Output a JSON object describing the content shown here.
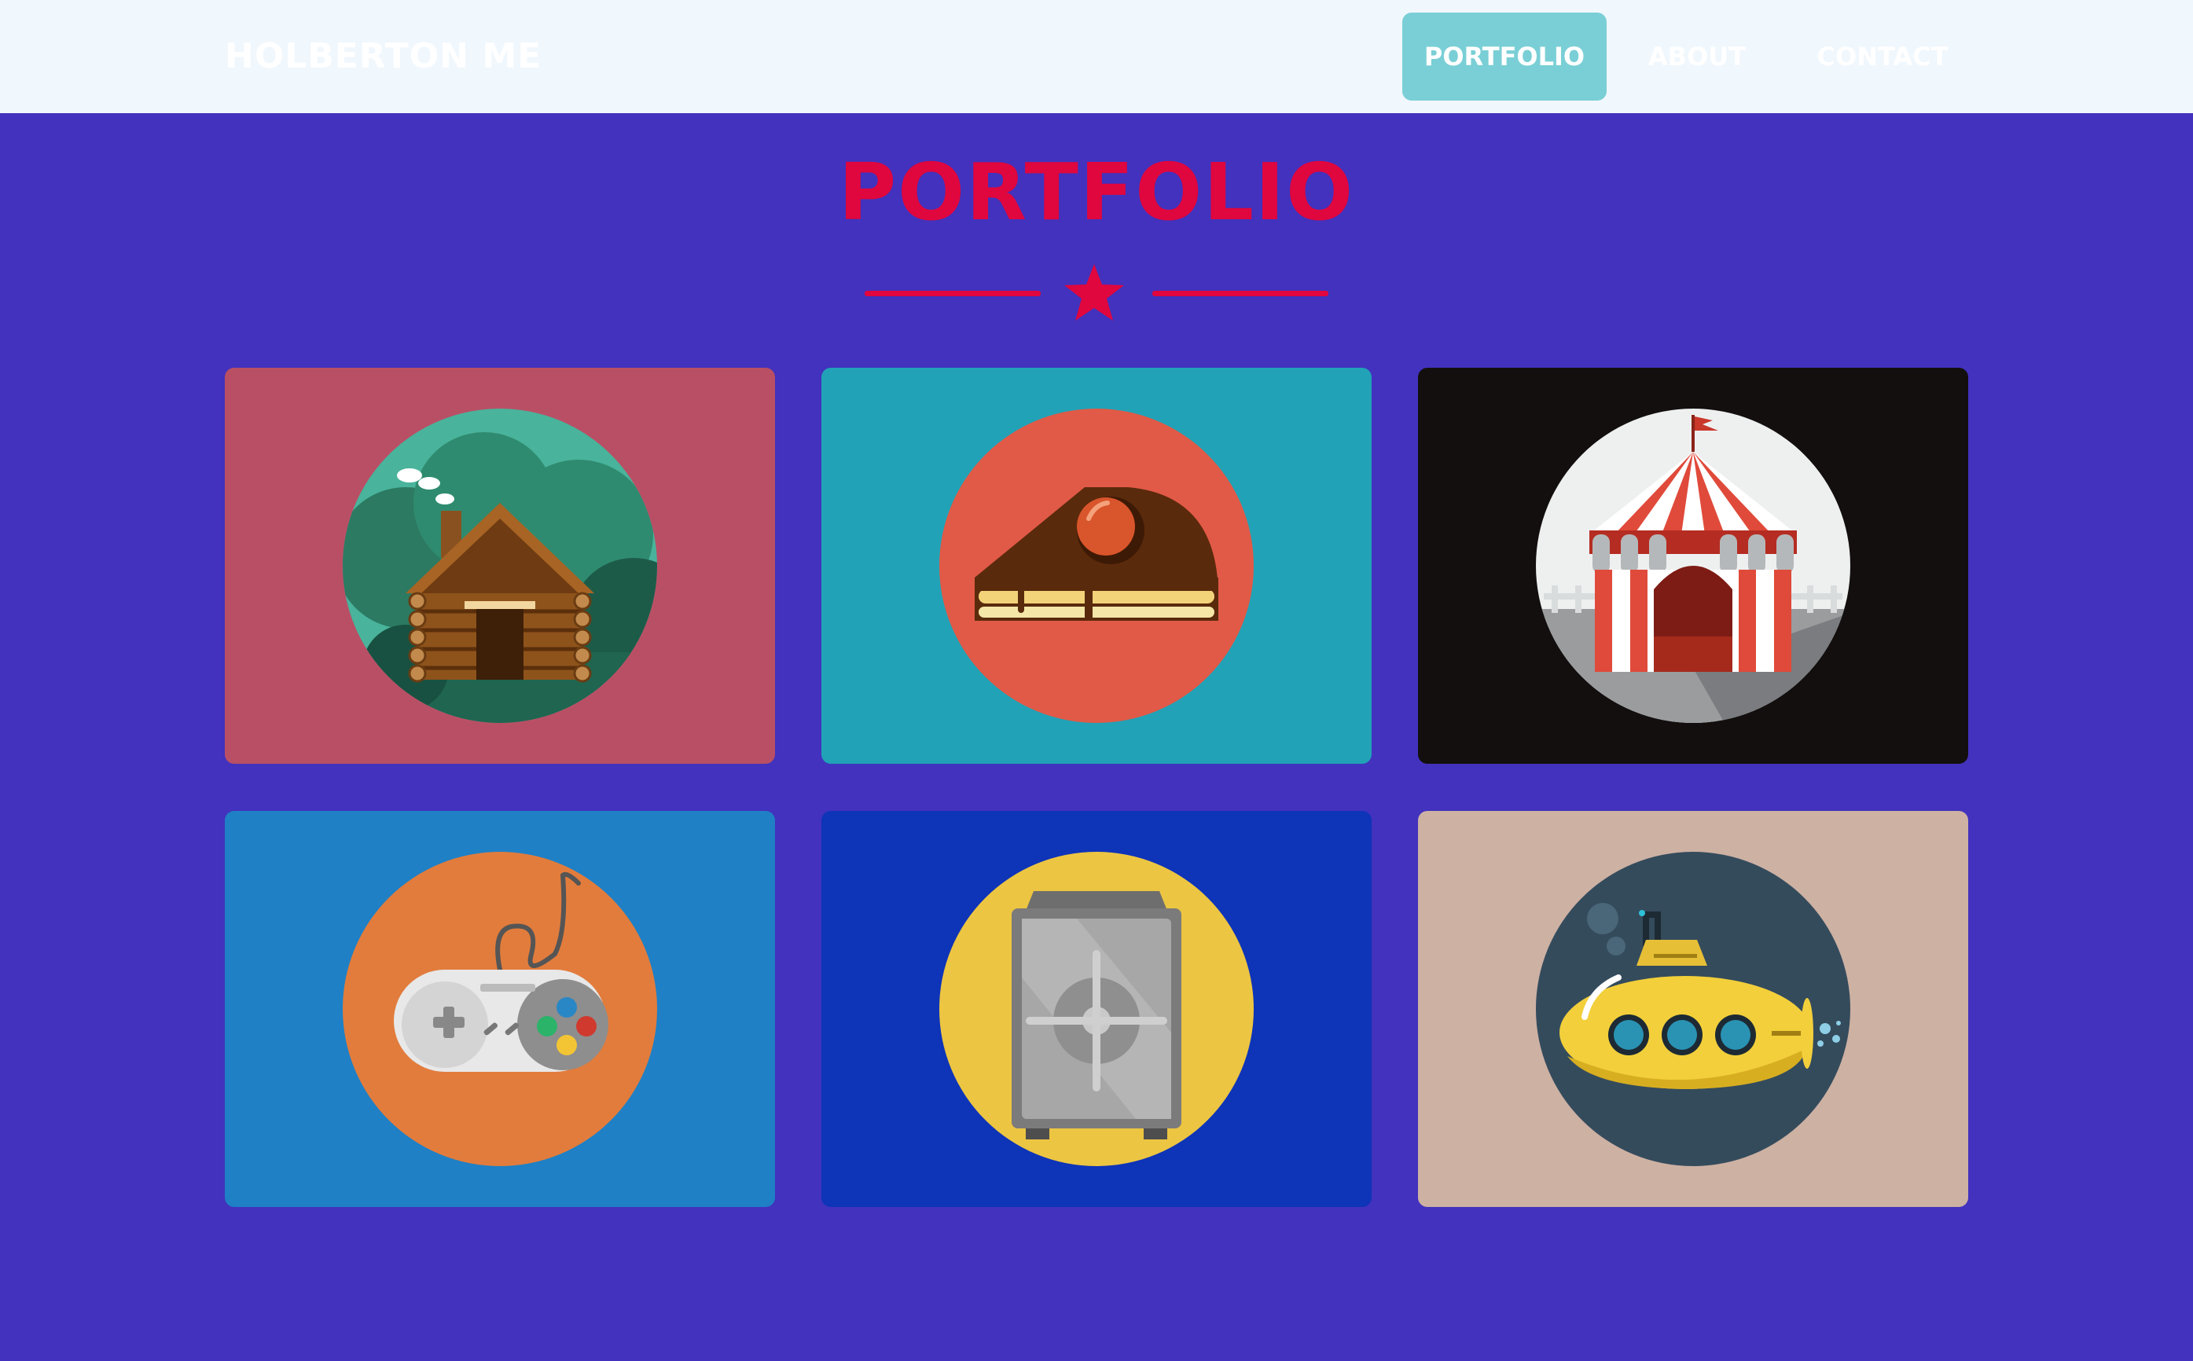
{
  "header": {
    "brand": "HOLBERTON ME",
    "nav": [
      {
        "label": "PORTFOLIO",
        "active": true
      },
      {
        "label": "ABOUT",
        "active": false
      },
      {
        "label": "CONTACT",
        "active": false
      }
    ]
  },
  "section": {
    "title": "PORTFOLIO",
    "divider_icon": "star-icon"
  },
  "portfolio": {
    "items": [
      {
        "icon": "log-cabin-icon",
        "card_color": "#b94f65",
        "circle_color": "#3e9e86"
      },
      {
        "icon": "cake-slice-icon",
        "card_color": "#21a2b7",
        "circle_color": "#e15a47"
      },
      {
        "icon": "circus-tent-icon",
        "card_color": "#130f0e",
        "circle_color": "#eef0f0"
      },
      {
        "icon": "game-controller-icon",
        "card_color": "#1f80c5",
        "circle_color": "#e27c3c"
      },
      {
        "icon": "safe-icon",
        "card_color": "#0e34b8",
        "circle_color": "#ecc542"
      },
      {
        "icon": "submarine-icon",
        "card_color": "#cdb1a3",
        "circle_color": "#344b5c"
      }
    ]
  },
  "colors": {
    "page_bg": "#4232bd",
    "header_bg": "#f0f7fd",
    "accent": "#e0063e",
    "nav_active_bg": "#7acfd6"
  }
}
